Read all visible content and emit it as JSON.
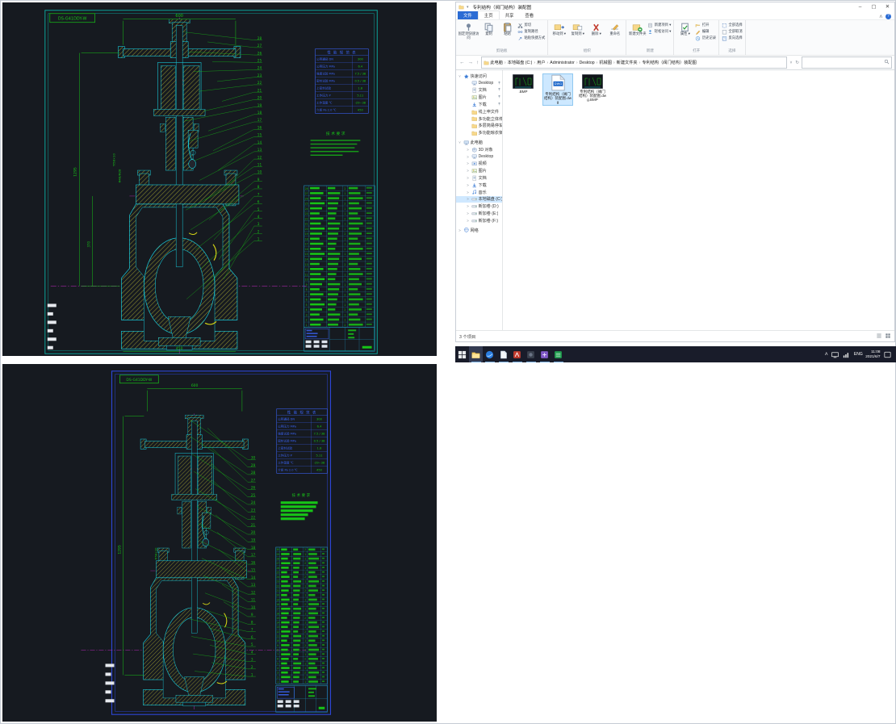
{
  "explorer": {
    "title": "专利结构（阀门结构）装配图",
    "window_controls": {
      "minimize": "–",
      "maximize": "▢",
      "close": "✕"
    },
    "menu_tabs": [
      {
        "label": "文件",
        "style": "file"
      },
      {
        "label": "主页",
        "style": "active"
      },
      {
        "label": "共享",
        "style": ""
      },
      {
        "label": "查看",
        "style": ""
      }
    ],
    "ribbon_collapse": "ᐱ",
    "help_label": "?",
    "ribbon_groups": [
      {
        "name": "剪贴板",
        "large": [
          {
            "label": "固定到快速访问",
            "icon": "pin-icon",
            "wide": true
          },
          {
            "label": "复制",
            "icon": "copy-icon"
          },
          {
            "label": "粘贴",
            "icon": "paste-icon"
          }
        ],
        "small": [
          {
            "label": "剪切",
            "icon": "cut-icon"
          },
          {
            "label": "复制路径",
            "icon": "path-icon"
          },
          {
            "label": "粘贴快捷方式",
            "icon": "shortcut-icon"
          }
        ]
      },
      {
        "name": "组织",
        "large": [
          {
            "label": "移动到",
            "icon": "moveto-icon",
            "dd": true
          },
          {
            "label": "复制到",
            "icon": "copyto-icon",
            "dd": true
          },
          {
            "label": "删除",
            "icon": "delete-icon",
            "dd": true
          },
          {
            "label": "重命名",
            "icon": "rename-icon"
          }
        ],
        "small": []
      },
      {
        "name": "新建",
        "large": [
          {
            "label": "新建文件夹",
            "icon": "newfolder-icon"
          }
        ],
        "small": [
          {
            "label": "新建项目",
            "icon": "newitem-icon",
            "dd": true
          },
          {
            "label": "轻松访问",
            "icon": "access-icon",
            "dd": true
          }
        ]
      },
      {
        "name": "打开",
        "large": [
          {
            "label": "属性",
            "icon": "properties-icon",
            "dd": true
          }
        ],
        "small": [
          {
            "label": "打开",
            "icon": "open-icon"
          },
          {
            "label": "编辑",
            "icon": "edit-icon"
          },
          {
            "label": "历史记录",
            "icon": "history-icon"
          }
        ]
      },
      {
        "name": "选择",
        "large": [],
        "small": [
          {
            "label": "全部选择",
            "icon": "selectall-icon"
          },
          {
            "label": "全部取消",
            "icon": "selectnone-icon"
          },
          {
            "label": "反向选择",
            "icon": "invert-icon"
          }
        ]
      }
    ],
    "nav_back": "←",
    "nav_fwd": "→",
    "nav_up": "↑",
    "breadcrumb": [
      "此电脑",
      "本地磁盘 (C:)",
      "用户",
      "Administrator",
      "Desktop",
      "机械图",
      "新建文件夹",
      "专利结构（阀门结构）装配图"
    ],
    "address_dropdown": "˅",
    "refresh_glyph": "↻",
    "search_placeholder": "",
    "sidebar": [
      {
        "label": "快速访问",
        "type": "root",
        "icon": "star-icon",
        "chev": "˅"
      },
      {
        "label": "Desktop",
        "type": "qa",
        "icon": "desktop-icon",
        "pinned": true
      },
      {
        "label": "文档",
        "type": "qa",
        "icon": "document-icon",
        "pinned": true
      },
      {
        "label": "图片",
        "type": "qa",
        "icon": "pictures-icon",
        "pinned": true
      },
      {
        "label": "下载",
        "type": "qa",
        "icon": "downloads-icon",
        "pinned": true
      },
      {
        "label": "线上申文件",
        "type": "qa",
        "icon": "folder-icon"
      },
      {
        "label": "多功能立体停车",
        "type": "qa",
        "icon": "folder-icon"
      },
      {
        "label": "多层简易停车库",
        "type": "qa",
        "icon": "folder-icon"
      },
      {
        "label": "多功能晾衣架",
        "type": "qa",
        "icon": "folder-icon"
      },
      {
        "label": "此电脑",
        "type": "root",
        "icon": "computer-icon",
        "chev": "˅"
      },
      {
        "label": "3D 对象",
        "type": "pc",
        "icon": "objects3d-icon",
        "chev": "˃"
      },
      {
        "label": "Desktop",
        "type": "pc",
        "icon": "desktop-icon",
        "chev": "˃"
      },
      {
        "label": "视频",
        "type": "pc",
        "icon": "videos-icon",
        "chev": "˃"
      },
      {
        "label": "图片",
        "type": "pc",
        "icon": "pictures-icon",
        "chev": "˃"
      },
      {
        "label": "文档",
        "type": "pc",
        "icon": "document-icon",
        "chev": "˃"
      },
      {
        "label": "下载",
        "type": "pc",
        "icon": "downloads-icon",
        "chev": "˃"
      },
      {
        "label": "音乐",
        "type": "pc",
        "icon": "music-icon",
        "chev": "˃"
      },
      {
        "label": "本地磁盘 (C:)",
        "type": "pc",
        "icon": "drive-icon",
        "chev": "˃",
        "selected": true
      },
      {
        "label": "新加卷 (D:)",
        "type": "pc",
        "icon": "drive-icon",
        "chev": "˃"
      },
      {
        "label": "新加卷 (E:)",
        "type": "pc",
        "icon": "drive-icon",
        "chev": "˃"
      },
      {
        "label": "新加卷 (F:)",
        "type": "pc",
        "icon": "drive-icon",
        "chev": "˃"
      },
      {
        "label": "网络",
        "type": "root",
        "icon": "network-icon",
        "chev": "˃"
      }
    ],
    "files": [
      {
        "name": ".BMP",
        "kind": "bmp-thumbnail"
      },
      {
        "name": "专利结构（阀门结构）装配图.dwg",
        "kind": "dwg",
        "selected": true
      },
      {
        "name": "专利结构（阀门结构）装配图.dwg.BMP",
        "kind": "bmp-thumbnail"
      }
    ],
    "status_left": "3 个项目"
  },
  "taskbar": {
    "apps": [
      {
        "name": "start",
        "icon": "windows-logo-icon"
      },
      {
        "name": "file-explorer",
        "icon": "explorer-icon",
        "active": true,
        "running": true
      },
      {
        "name": "browser",
        "icon": "browser-icon",
        "running": true
      },
      {
        "name": "documents-app",
        "icon": "doc-app-icon",
        "running": true
      },
      {
        "name": "red-app",
        "icon": "red-app-icon",
        "running": true
      },
      {
        "name": "dark-app",
        "icon": "dark-app-icon",
        "running": true
      },
      {
        "name": "purple-app",
        "icon": "purple-app-icon",
        "running": true
      },
      {
        "name": "green-app",
        "icon": "green-app-icon",
        "running": true
      }
    ],
    "tray": {
      "chevron": "ᐱ",
      "lang": "ENG",
      "time": "11:08",
      "date": "2021/6/7"
    }
  },
  "cad_top": {
    "corner_label": "DS-G41DDY-W",
    "dims": {
      "top": "600",
      "left": "1295",
      "left2": "370",
      "bottom": "450",
      "stem1": "Tr58×10",
      "stem2": "Φ48/Φ28"
    },
    "param_table": {
      "title": "性 能 规 范 表",
      "rows": [
        [
          "公称通径 DN",
          "300"
        ],
        [
          "公称压力 MPa",
          "6.4"
        ],
        [
          "强度试验 MPa",
          "7.5 / 38"
        ],
        [
          "密封试验 MPa",
          "0.5 / 38"
        ],
        [
          "上密封试验",
          "1.8"
        ],
        [
          "工作压力 P",
          "5.11"
        ],
        [
          "工作温度 ℃",
          "-29~38"
        ],
        [
          "介质 Pa 2.0 ℃",
          "450"
        ]
      ]
    },
    "notes_title": "技术要求",
    "callout_count": 28,
    "bom_rows": 28
  },
  "cad_bottom": {
    "corner_label": "DS-G41DDY-W",
    "dims": {
      "top": "600",
      "left": "1295",
      "stem1": "Tr58×10"
    },
    "notes_title": "技术要求",
    "bars": [
      46,
      44,
      40,
      34,
      30
    ],
    "callout_count": 30,
    "bom_rows": 30
  },
  "colors": {
    "cad_bg": "#161a20",
    "cad_frame_top": "#0ca39a",
    "cad_frame_bottom": "#2d46d8",
    "cad_green": "#17c417",
    "cad_cyan": "#18c8d8",
    "cad_magenta": "#c928c9",
    "cad_red": "#c41414",
    "cad_blue": "#3a62f0",
    "hatch": "#8e8e2e",
    "taskbar": "#191c2a",
    "accent": "#2b6cd4"
  }
}
